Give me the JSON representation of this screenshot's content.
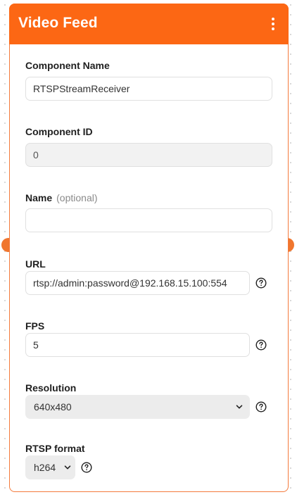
{
  "header": {
    "title": "Video Feed",
    "menu_icon": "more-vertical-icon"
  },
  "fields": {
    "component_name": {
      "label": "Component Name",
      "value": "RTSPStreamReceiver"
    },
    "component_id": {
      "label": "Component ID",
      "value": "0"
    },
    "name": {
      "label": "Name",
      "optional": "(optional)",
      "value": ""
    },
    "url": {
      "label": "URL",
      "value": "rtsp://admin:password@192.168.15.100:554"
    },
    "fps": {
      "label": "FPS",
      "value": "5"
    },
    "resolution": {
      "label": "Resolution",
      "value": "640x480"
    },
    "rtsp_format": {
      "label": "RTSP format",
      "value": "h264"
    }
  },
  "colors": {
    "accent": "#fc6714",
    "handle": "#f0762e"
  },
  "icons": {
    "help": "help-circle-icon",
    "chevron": "chevron-down-icon"
  }
}
